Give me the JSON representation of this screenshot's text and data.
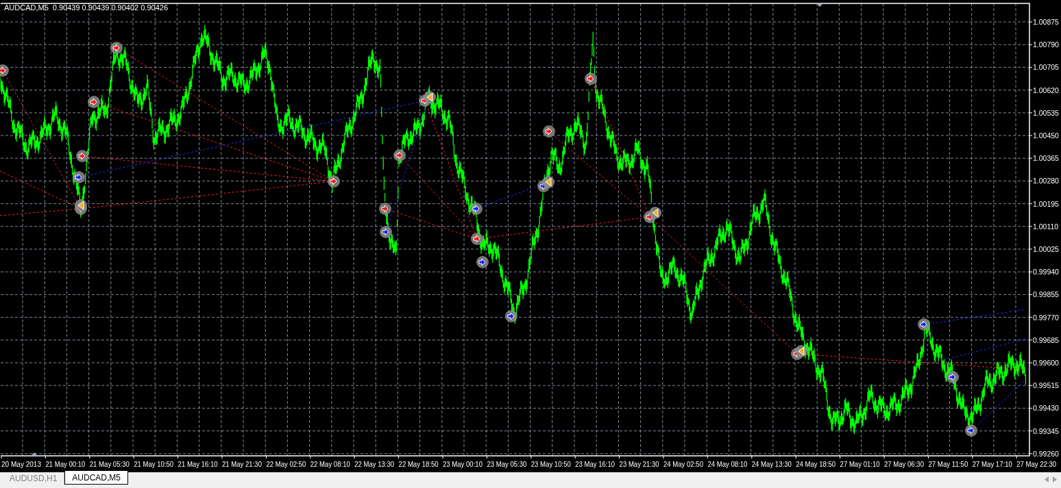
{
  "chart": {
    "symbol": "AUDCAD,M5",
    "quotes": [
      "0.90439",
      "0.90439",
      "0.90402",
      "0.90426"
    ],
    "price_labels": [
      "1.00875",
      "1.00790",
      "1.00705",
      "1.00620",
      "1.00535",
      "1.00450",
      "1.00365",
      "1.00280",
      "1.00195",
      "1.00110",
      "1.00025",
      "0.99940",
      "0.99855",
      "0.99770",
      "0.99685",
      "0.99600",
      "0.99515",
      "0.99430",
      "0.99345",
      "0.99260"
    ],
    "time_labels": [
      "20 May 2013",
      "21 May 00:10",
      "21 May 05:30",
      "21 May 10:50",
      "21 May 16:10",
      "21 May 21:30",
      "22 May 02:50",
      "22 May 08:10",
      "22 May 13:30",
      "22 May 18:50",
      "23 May 00:10",
      "23 May 05:30",
      "23 May 10:50",
      "23 May 16:10",
      "23 May 21:30",
      "24 May 02:50",
      "24 May 08:10",
      "24 May 13:30",
      "24 May 18:50",
      "27 May 01:10",
      "27 May 06:30",
      "27 May 11:50",
      "27 May 17:10",
      "27 May 22:30"
    ]
  },
  "tabs": [
    {
      "label": "AUDUSD,H1",
      "selected": false
    },
    {
      "label": "AUDCAD,M5",
      "selected": true
    }
  ]
}
